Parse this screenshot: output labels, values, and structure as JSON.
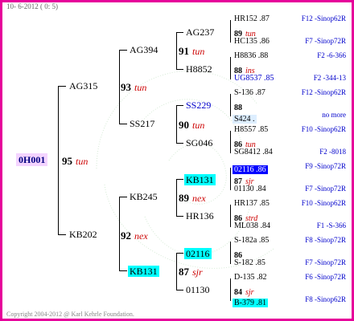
{
  "header": "10- 6-2012 ( 0: 5)",
  "footer": "Copyright 2004-2012 @ Karl Kehrle Foundation.",
  "colors": {
    "frame": "#e6009a",
    "remark": "#cc0000",
    "note": "#0000cc",
    "highlight_cyan": "#00ffff",
    "highlight_blue": "#0000ff",
    "root_bg": "#f4d4ff"
  },
  "root": {
    "name": "0H001",
    "num": "95",
    "remark": "tun"
  },
  "gen1": [
    {
      "name": "AG315",
      "num": "93",
      "remark": "tun"
    },
    {
      "name": "KB202",
      "num": "92",
      "remark": "nex"
    }
  ],
  "gen2": [
    {
      "name": "AG394",
      "num": "91",
      "remark": "tun"
    },
    {
      "name": "SS217",
      "num": "90",
      "remark": "tun"
    },
    {
      "name": "KB245",
      "num": "89",
      "remark": "nex"
    },
    {
      "name": "KB131",
      "num": "87",
      "remark": "sjr"
    }
  ],
  "gen3": [
    {
      "name": "AG237",
      "num": "89",
      "remark": "tun"
    },
    {
      "name": "H8852",
      "num": "88",
      "remark": "ins"
    },
    {
      "name": "SS229",
      "num": "88",
      "remark": ""
    },
    {
      "name": "SG046",
      "num": "86",
      "remark": "tun"
    },
    {
      "name": "KB131",
      "num": "87",
      "remark": "sjr"
    },
    {
      "name": "HR136",
      "num": "86",
      "remark": "strd"
    },
    {
      "name": "02116",
      "num": "86",
      "remark": ""
    },
    {
      "name": "01130",
      "num": "84",
      "remark": "sjr"
    }
  ],
  "gen4": [
    {
      "name": "HR152 .87",
      "note": "F12 -Sinop62R"
    },
    {
      "name": "HC135 .86",
      "note": "F7 -Sinop72R"
    },
    {
      "name": "H8836 .88",
      "note": "F2 -6-366"
    },
    {
      "name": "UG8537 .85",
      "note": "F2 -344-13"
    },
    {
      "name": "S-136 .87",
      "note": "F12 -Sinop62R"
    },
    {
      "name": "S424 .",
      "note": "no more"
    },
    {
      "name": "H8557 .85",
      "note": "F10 -Sinop62R"
    },
    {
      "name": "SG8412 .84",
      "note": "F2 -8018"
    },
    {
      "name": "02116 .86",
      "note": "F9 -Sinop72R"
    },
    {
      "name": "01130 .84",
      "note": "F7 -Sinop72R"
    },
    {
      "name": "HR137 .85",
      "note": "F10 -Sinop62R"
    },
    {
      "name": "ML038 .84",
      "note": "F1 -S-366"
    },
    {
      "name": "S-182a .85",
      "note": "F8 -Sinop72R"
    },
    {
      "name": "S-182 .85",
      "note": "F7 -Sinop72R"
    },
    {
      "name": "D-135 .82",
      "note": "F6 -Sinop72R"
    },
    {
      "name": "B-379 .81",
      "note": "F8 -Sinop62R"
    }
  ]
}
